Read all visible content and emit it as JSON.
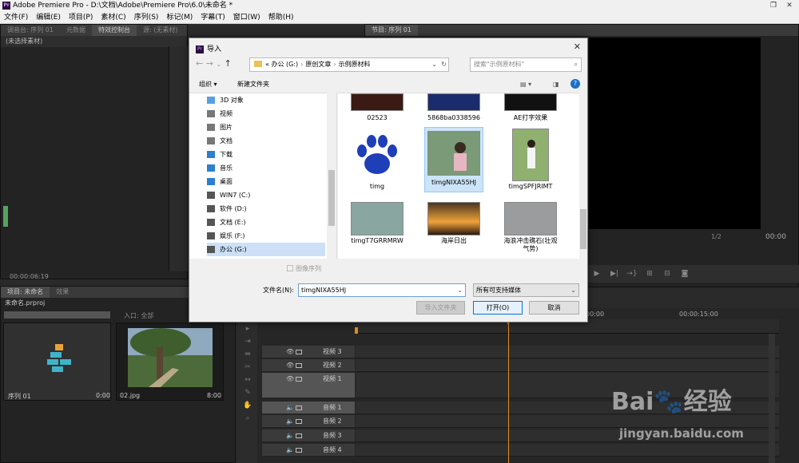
{
  "app": {
    "title": "Adobe Premiere Pro - D:\\文档\\Adobe\\Premiere Pro\\6.0\\未命名 *",
    "logo_text": "Pr",
    "restore_icon": "restore-icon",
    "close_icon": "close-icon"
  },
  "menu": [
    "文件(F)",
    "编辑(E)",
    "项目(P)",
    "素材(C)",
    "序列(S)",
    "标记(M)",
    "字幕(T)",
    "窗口(W)",
    "帮助(H)"
  ],
  "left_panel": {
    "tabs": [
      "调音台: 序列 01",
      "元数据",
      "特效控制台",
      "源: (无素材)"
    ],
    "subheader": "(未选择素材)",
    "timecode": "00:00:06:19"
  },
  "right_panel": {
    "tab": "节目: 序列 01",
    "zoom": "1/2",
    "timecode": "00:00"
  },
  "project": {
    "tabs": [
      "项目: 未命名",
      "效果"
    ],
    "file": "未命名.prproj",
    "in_label": "入口: 全部",
    "items": [
      {
        "name": "序列 01",
        "duration": "0:00"
      },
      {
        "name": "02.jpg",
        "duration": "8:00"
      }
    ]
  },
  "timeline": {
    "ticks": [
      "00:00",
      "00:00:15:00"
    ],
    "tracks": [
      {
        "label": "视频 3",
        "kind": "video"
      },
      {
        "label": "视频 2",
        "kind": "video"
      },
      {
        "label": "视频 1",
        "kind": "video"
      },
      {
        "label": "音频 1",
        "kind": "audio"
      },
      {
        "label": "音频 2",
        "kind": "audio"
      },
      {
        "label": "音频 3",
        "kind": "audio"
      },
      {
        "label": "音频 4",
        "kind": "audio"
      }
    ]
  },
  "dialog": {
    "title": "导入",
    "path": [
      "办公 (G:)",
      "原创文章",
      "示例原材料"
    ],
    "path_prefix": "«",
    "search_placeholder": "搜索\"示例原材料\"",
    "organize": "组织 ▾",
    "new_folder": "新建文件夹",
    "tree": [
      {
        "label": "3D 对象",
        "icon": "3d-objects-icon",
        "color": "#5aa0e0"
      },
      {
        "label": "视频",
        "icon": "video-folder-icon",
        "color": "#777777"
      },
      {
        "label": "图片",
        "icon": "pictures-folder-icon",
        "color": "#777777"
      },
      {
        "label": "文档",
        "icon": "documents-folder-icon",
        "color": "#777777"
      },
      {
        "label": "下载",
        "icon": "downloads-folder-icon",
        "color": "#2d7fd1"
      },
      {
        "label": "音乐",
        "icon": "music-folder-icon",
        "color": "#2d7fd1"
      },
      {
        "label": "桌面",
        "icon": "desktop-folder-icon",
        "color": "#2d7fd1"
      },
      {
        "label": "WIN7 (C:)",
        "icon": "drive-icon",
        "color": "#555555"
      },
      {
        "label": "软件 (D:)",
        "icon": "drive-icon",
        "color": "#555555"
      },
      {
        "label": "文档 (E:)",
        "icon": "drive-icon",
        "color": "#555555"
      },
      {
        "label": "娱乐 (F:)",
        "icon": "drive-icon",
        "color": "#555555"
      },
      {
        "label": "办公 (G:)",
        "icon": "drive-icon",
        "color": "#555555"
      }
    ],
    "files": [
      {
        "name": "02523",
        "kind": "video"
      },
      {
        "name": "5868ba0338596",
        "kind": "video"
      },
      {
        "name": "AE打字效果",
        "kind": "video"
      },
      {
        "name": "timg",
        "kind": "image"
      },
      {
        "name": "timgNIXA55HJ",
        "kind": "image"
      },
      {
        "name": "timgSPFJRIMT",
        "kind": "image"
      },
      {
        "name": "timgT7GRRMRW",
        "kind": "video"
      },
      {
        "name": "海岸日出",
        "kind": "video"
      },
      {
        "name": "海浪冲击礁石(壮观气势)",
        "kind": "video"
      }
    ],
    "image_sequence": "图像序列",
    "filename_label": "文件名(N):",
    "filename_value": "timgNIXA55HJ",
    "filter": "所有可支持媒体",
    "btn_import_folder": "导入文件夹",
    "btn_open": "打开(O)",
    "btn_cancel": "取消"
  },
  "watermark": {
    "logo": "Bai🐾经验",
    "url": "jingyan.baidu.com"
  }
}
